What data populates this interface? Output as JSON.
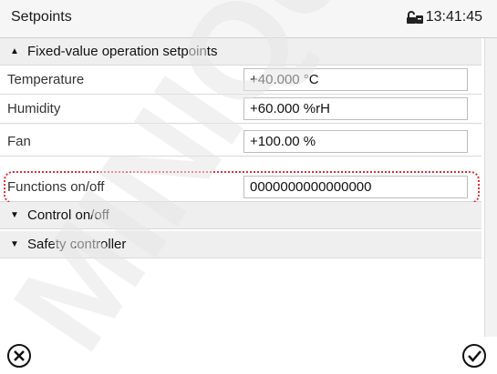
{
  "header": {
    "title": "Setpoints",
    "time": "13:41:45",
    "icons": [
      "lock-icon"
    ]
  },
  "groups": {
    "fixed_value": "Fixed-value operation setpoints",
    "control": "Control on/off",
    "safety": "Safety controller"
  },
  "params": [
    {
      "label": "Temperature",
      "value": "+40.000 °C"
    },
    {
      "label": "Humidity",
      "value": "+60.000 %rH"
    },
    {
      "label": "Fan",
      "value": "+100.00 %"
    },
    {
      "label": "Functions on/off",
      "value": "0000000000000000"
    }
  ],
  "footer": {
    "icons": [
      "cancel-icon",
      "confirm-icon"
    ]
  },
  "watermark": "MINIQUICK",
  "colors": {
    "highlight": "#e0303a",
    "header_bg": "#f6f6f6",
    "group_bg": "#efefef"
  }
}
